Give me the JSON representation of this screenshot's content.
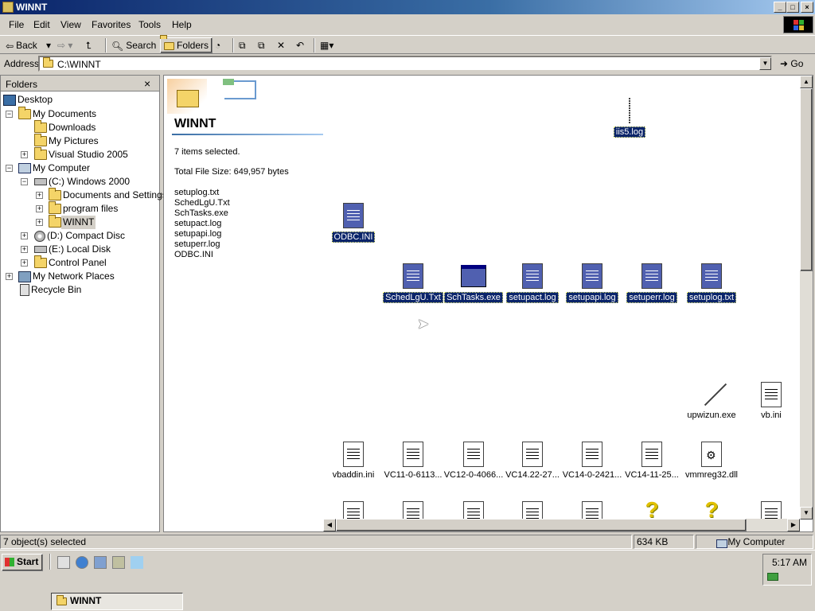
{
  "window": {
    "title": "WINNT"
  },
  "menu": [
    "File",
    "Edit",
    "View",
    "Favorites",
    "Tools",
    "Help"
  ],
  "toolbar": {
    "back": "Back",
    "search": "Search",
    "folders": "Folders"
  },
  "address": {
    "label": "Address",
    "value": "C:\\WINNT",
    "go": "Go"
  },
  "folders_pane": {
    "title": "Folders",
    "items": [
      {
        "label": "Desktop",
        "icon": "desktop-icon"
      },
      {
        "label": "My Documents",
        "icon": "folder-icon"
      },
      {
        "label": "Downloads",
        "icon": "folder-icon"
      },
      {
        "label": "My Pictures",
        "icon": "folder-icon"
      },
      {
        "label": "Visual Studio 2005",
        "icon": "folder-icon"
      },
      {
        "label": "My Computer",
        "icon": "computer-icon"
      },
      {
        "label": "(C:) Windows 2000",
        "icon": "drive-icon"
      },
      {
        "label": "Documents and Settings",
        "icon": "folder-icon"
      },
      {
        "label": "program files",
        "icon": "folder-icon"
      },
      {
        "label": "WINNT",
        "icon": "folder-icon",
        "selected": true
      },
      {
        "label": "(D:) Compact Disc",
        "icon": "cd-icon"
      },
      {
        "label": "(E:) Local Disk",
        "icon": "drive-icon"
      },
      {
        "label": "Control Panel",
        "icon": "folder-icon"
      },
      {
        "label": "My Network Places",
        "icon": "network-icon"
      },
      {
        "label": "Recycle Bin",
        "icon": "recycle-bin-icon"
      }
    ]
  },
  "webview": {
    "folder_name": "WINNT",
    "selected_count": "7 items selected.",
    "total_size": "Total File Size: 649,957 bytes",
    "selected_files": [
      "setuplog.txt",
      "SchedLgU.Txt",
      "SchTasks.exe",
      "setupact.log",
      "setupapi.log",
      "setuperr.log",
      "ODBC.INI"
    ]
  },
  "files": [
    {
      "name": "iis5.log",
      "selected": true,
      "icon": "log-line-icon"
    },
    {
      "name": "ODBC.INI",
      "selected": true,
      "icon": "ini-file-icon"
    },
    {
      "name": "SchedLgU.Txt",
      "selected": true,
      "icon": "text-file-icon"
    },
    {
      "name": "SchTasks.exe",
      "selected": true,
      "icon": "exe-icon"
    },
    {
      "name": "setupact.log",
      "selected": true,
      "icon": "text-file-icon"
    },
    {
      "name": "setupapi.log",
      "selected": true,
      "icon": "text-file-icon"
    },
    {
      "name": "setuperr.log",
      "selected": true,
      "icon": "text-file-icon"
    },
    {
      "name": "setuplog.txt",
      "selected": true,
      "icon": "text-file-icon"
    },
    {
      "name": "upwizun.exe",
      "selected": false,
      "icon": "wand-icon"
    },
    {
      "name": "vb.ini",
      "selected": false,
      "icon": "ini-file-icon"
    },
    {
      "name": "vbaddin.ini",
      "selected": false,
      "icon": "ini-file-icon"
    },
    {
      "name": "VC11-0-6113...",
      "selected": false,
      "icon": "text-file-icon"
    },
    {
      "name": "VC12-0-4066...",
      "selected": false,
      "icon": "text-file-icon"
    },
    {
      "name": "VC14.22-27...",
      "selected": false,
      "icon": "text-file-icon"
    },
    {
      "name": "VC14-0-2421...",
      "selected": false,
      "icon": "text-file-icon"
    },
    {
      "name": "VC14-11-25...",
      "selected": false,
      "icon": "text-file-icon"
    },
    {
      "name": "vmmreg32.dll",
      "selected": false,
      "icon": "dll-gear-icon"
    }
  ],
  "status": {
    "selection": "7 object(s) selected",
    "size": "634 KB",
    "zone": "My Computer"
  },
  "taskbar": {
    "start": "Start",
    "clock": "5:17 AM",
    "task": "WINNT"
  }
}
